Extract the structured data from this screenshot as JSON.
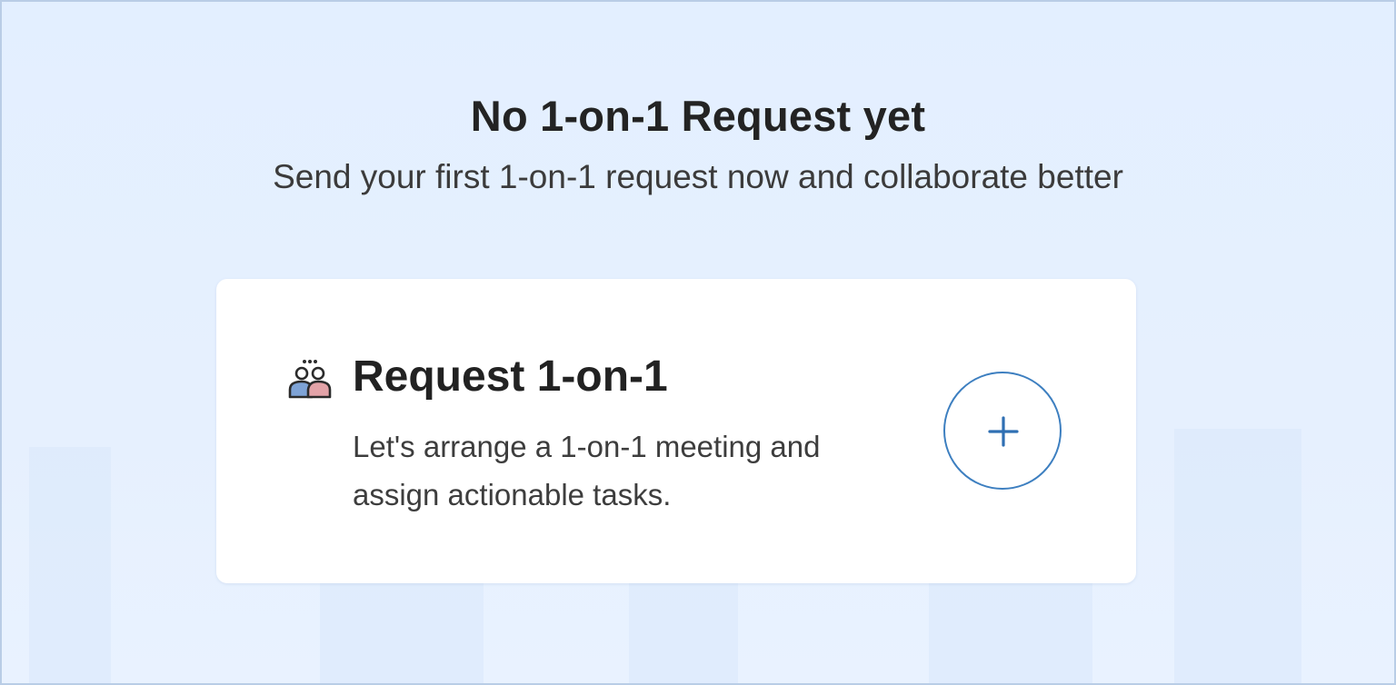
{
  "empty_state": {
    "title": "No 1-on-1 Request yet",
    "subtitle": "Send your first 1-on-1 request now and collaborate better"
  },
  "card": {
    "icon": "people-meeting-icon",
    "title": "Request 1-on-1",
    "description": "Let's arrange a 1-on-1 meeting and assign actionable tasks.",
    "add_icon": "plus-icon"
  },
  "colors": {
    "background": "#e3efff",
    "card": "#ffffff",
    "accent": "#3d7fc0",
    "icon_left_person": "#7ea3d6",
    "icon_right_person": "#e3a3a8"
  }
}
